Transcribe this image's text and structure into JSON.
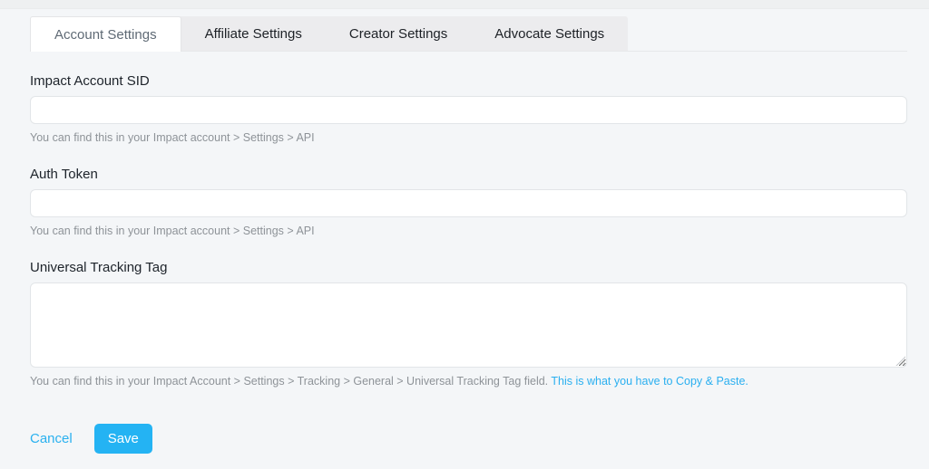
{
  "tabs": {
    "items": [
      {
        "label": "Account Settings",
        "active": true
      },
      {
        "label": "Affiliate Settings",
        "active": false
      },
      {
        "label": "Creator Settings",
        "active": false
      },
      {
        "label": "Advocate Settings",
        "active": false
      }
    ]
  },
  "form": {
    "impact_sid": {
      "label": "Impact Account SID",
      "value": "",
      "help": "You can find this in your Impact account > Settings > API"
    },
    "auth_token": {
      "label": "Auth Token",
      "value": "",
      "help": "You can find this in your Impact account > Settings > API"
    },
    "tracking_tag": {
      "label": "Universal Tracking Tag",
      "value": "",
      "help": "You can find this in your Impact Account > Settings > Tracking > General > Universal Tracking Tag field.",
      "help_link": "This is what you have to Copy & Paste."
    }
  },
  "actions": {
    "cancel": "Cancel",
    "save": "Save"
  },
  "colors": {
    "accent": "#24b3f3",
    "link": "#2aaff0",
    "page_background": "#f4f6f8",
    "tab_strip_background": "#ececee"
  }
}
